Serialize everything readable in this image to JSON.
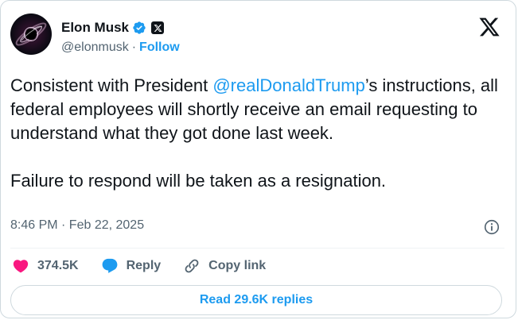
{
  "author": {
    "name": "Elon Musk",
    "handle": "@elonmusk",
    "separator": "·",
    "follow_label": "Follow"
  },
  "tweet": {
    "text_prefix": "Consistent with President ",
    "mention": "@realDonaldTrump",
    "text_suffix": "’s instructions, all federal employees will shortly receive an email requesting to understand what they got done last week.",
    "second_paragraph": "Failure to respond will be taken as a resignation.",
    "timestamp": "8:46 PM · Feb 22, 2025"
  },
  "actions": {
    "like_count": "374.5K",
    "reply_label": "Reply",
    "copy_link_label": "Copy link"
  },
  "read_replies_label": "Read 29.6K replies",
  "colors": {
    "accent": "#1d9bf0",
    "like": "#f91880",
    "text": "#0f1419",
    "muted": "#536471",
    "border": "#cfd9de"
  },
  "icons": [
    "verified-badge-icon",
    "x-affiliate-badge-icon",
    "x-logo-icon",
    "info-icon",
    "heart-icon",
    "reply-bubble-icon",
    "link-icon"
  ]
}
